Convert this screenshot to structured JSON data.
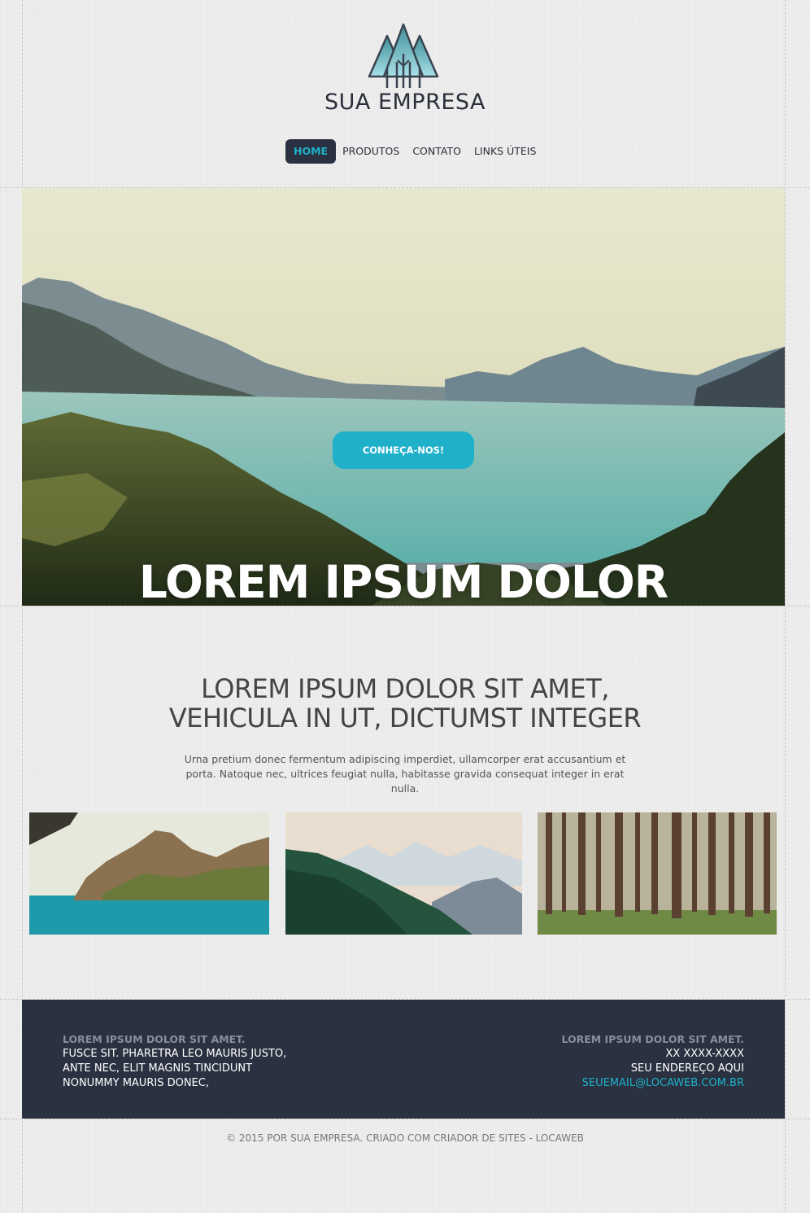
{
  "header": {
    "brand": "SUA EMPRESA",
    "logo_icon": "trees-logo-icon"
  },
  "nav": {
    "items": [
      "HOME",
      "PRODUTOS",
      "CONTATO",
      "LINKS ÚTEIS"
    ],
    "active": "HOME"
  },
  "hero": {
    "title": "LOREM IPSUM DOLOR",
    "button_label": "CONHEÇA-NOS!"
  },
  "intro": {
    "title_line1": "LOREM IPSUM DOLOR SIT AMET,",
    "title_line2": "VEHICULA IN UT, DICTUMST INTEGER",
    "text_line1": "Urna pretium donec fermentum adipiscing imperdiet, ullamcorper erat accusantium et",
    "text_line2": "porta. Natoque nec, ultrices feugiat nulla, habitasse gravida consequat integer in erat nulla."
  },
  "footer": {
    "left": {
      "heading": "LOREM IPSUM DOLOR SIT AMET.",
      "line1": "FUSCE SIT. PHARETRA LEO MAURIS JUSTO,",
      "line2": "ANTE NEC, ELIT MAGNIS TINCIDUNT",
      "line3": "NONUMMY MAURIS DONEC,"
    },
    "right": {
      "heading": "LOREM IPSUM DOLOR SIT AMET.",
      "phone": "XX XXXX-XXXX",
      "address": "SEU ENDEREÇO AQUI",
      "email": "SEUEMAIL@LOCAWEB.COM.BR"
    }
  },
  "copyright": "© 2015 POR SUA EMPRESA. CRIADO COM CRIADOR DE SITES - LOCAWEB",
  "colors": {
    "accent": "#1fb1c9",
    "dark": "#2a3140",
    "background": "#efefef"
  }
}
